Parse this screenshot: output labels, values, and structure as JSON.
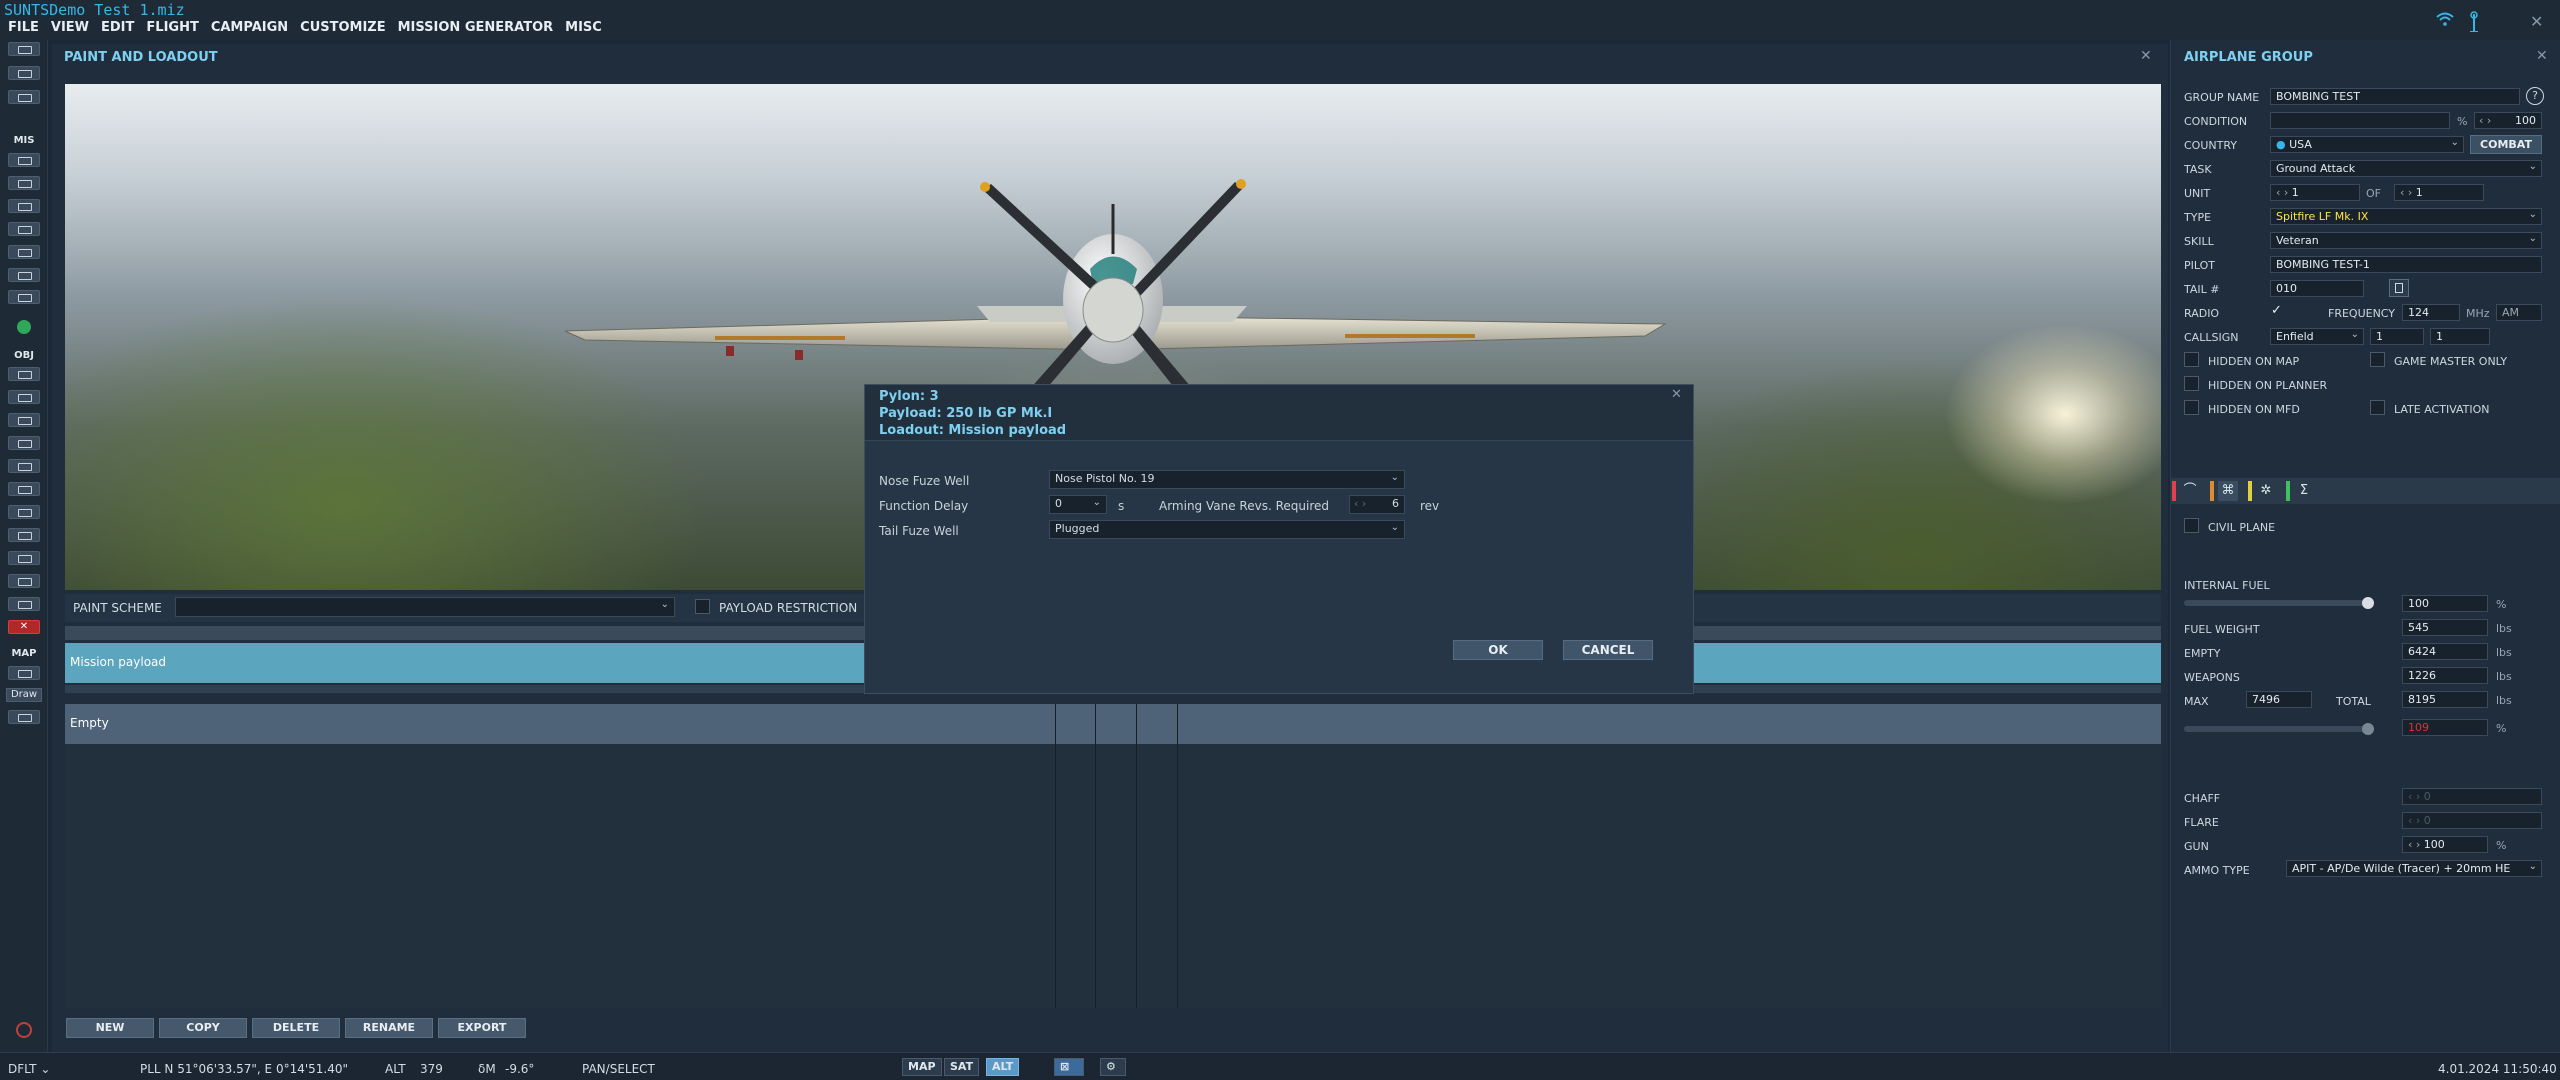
{
  "app": {
    "file_title": "SUNTSDemo Test 1.miz"
  },
  "menu": [
    "FILE",
    "VIEW",
    "EDIT",
    "FLIGHT",
    "CAMPAIGN",
    "CUSTOMIZE",
    "MISSION GENERATOR",
    "MISC"
  ],
  "left_toolbar": {
    "mis_label": "MIS",
    "obj_label": "OBJ",
    "map_label": "MAP",
    "draw_label": "Draw"
  },
  "paint_loadout": {
    "title": "PAINT AND LOADOUT",
    "paint_scheme_label": "PAINT SCHEME",
    "paint_scheme_value": "",
    "payload_restriction_label": "PAYLOAD RESTRICTION",
    "mission_payload": "Mission payload",
    "empty_row": "Empty",
    "buttons": {
      "new": "NEW",
      "copy": "COPY",
      "delete": "DELETE",
      "rename": "RENAME",
      "export": "EXPORT"
    }
  },
  "dialog": {
    "pylon": "Pylon: 3",
    "payload": "Payload: 250 lb GP Mk.I",
    "loadout": "Loadout: Mission payload",
    "nose_fuze_label": "Nose Fuze Well",
    "nose_fuze_value": "Nose Pistol No. 19",
    "function_delay_label": "Function Delay",
    "function_delay_value": "0",
    "function_delay_unit": "s",
    "arming_label": "Arming Vane Revs. Required",
    "arming_value": "6",
    "arming_unit": "rev",
    "tail_fuze_label": "Tail Fuze Well",
    "tail_fuze_value": "Plugged",
    "ok": "OK",
    "cancel": "CANCEL"
  },
  "airplane_group": {
    "title": "AIRPLANE GROUP",
    "group_name_label": "GROUP NAME",
    "group_name": "BOMBING TEST",
    "help": "?",
    "condition_label": "CONDITION",
    "condition_unit": "%",
    "condition_value": "100",
    "country_label": "COUNTRY",
    "country": "USA",
    "combat": "COMBAT",
    "task_label": "TASK",
    "task": "Ground Attack",
    "unit_label": "UNIT",
    "unit_value": "1",
    "of_label": "OF",
    "unit_of": "1",
    "type_label": "TYPE",
    "type": "Spitfire LF Mk. IX",
    "skill_label": "SKILL",
    "skill": "Veteran",
    "pilot_label": "PILOT",
    "pilot": "BOMBING TEST-1",
    "tail_label": "TAIL #",
    "tail": "010",
    "radio_label": "RADIO",
    "frequency_label": "FREQUENCY",
    "frequency": "124",
    "mhz": "MHz",
    "am": "AM",
    "callsign_label": "CALLSIGN",
    "callsign": "Enfield",
    "callsign_n1": "1",
    "callsign_n2": "1",
    "hidden_map": "HIDDEN ON MAP",
    "gm_only": "GAME MASTER ONLY",
    "hidden_planner": "HIDDEN ON PLANNER",
    "hidden_mfd": "HIDDEN ON MFD",
    "late_activation": "LATE ACTIVATION",
    "civil_plane": "CIVIL PLANE",
    "internal_fuel_label": "INTERNAL FUEL",
    "internal_fuel": "100",
    "pct": "%",
    "fuel_weight_label": "FUEL WEIGHT",
    "fuel_weight": "545",
    "empty_label": "EMPTY",
    "empty": "6424",
    "weapons_label": "WEAPONS",
    "weapons": "1226",
    "max_label": "MAX",
    "max": "7496",
    "total_label": "TOTAL",
    "total": "8195",
    "load_pct": "109",
    "lbs": "lbs",
    "chaff_label": "CHAFF",
    "chaff": "0",
    "flare_label": "FLARE",
    "flare": "0",
    "gun_label": "GUN",
    "gun": "100",
    "ammo_label": "AMMO TYPE",
    "ammo": "APIT - AP/De Wilde (Tracer) + 20mm HE"
  },
  "status": {
    "profile": "DFLT",
    "coords": "PLL  N 51°06'33.57\", E  0°14'51.40\"",
    "alt_label": "ALT",
    "alt": "379",
    "dm_label": "δM",
    "dm": "-9.6°",
    "mode": "PAN/SELECT",
    "map_btn": "MAP",
    "sat_btn": "SAT",
    "alt_btn": "ALT",
    "datetime": "4.01.2024 11:50:40"
  },
  "colors": {
    "accent": "#7fd0f0",
    "selected_row": "#5ba5be",
    "type_text": "#ffe24a",
    "overload": "#e03030"
  }
}
